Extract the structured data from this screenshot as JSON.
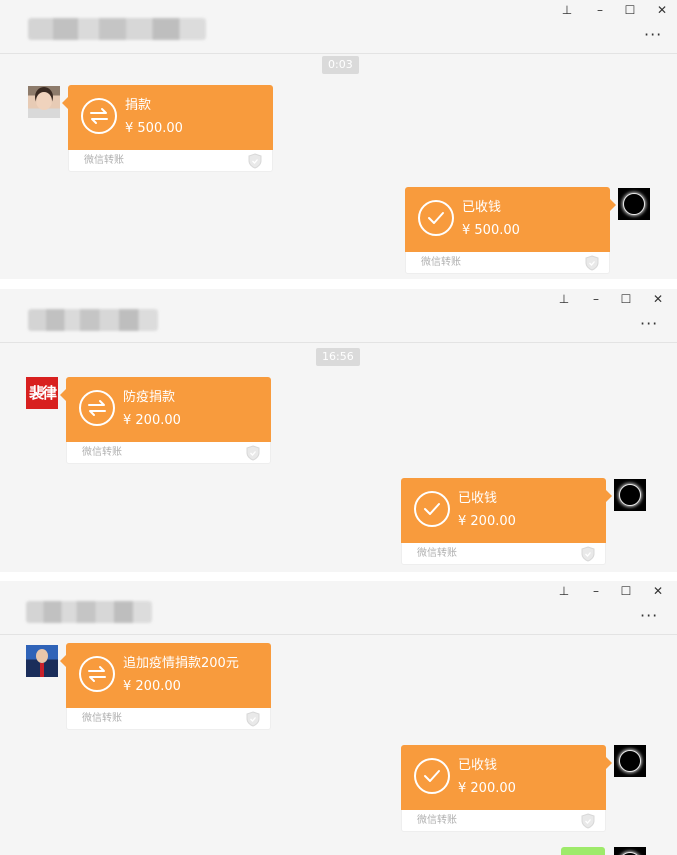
{
  "window_controls": {
    "pin": "⊥",
    "minimize": "–",
    "maximize": "☐",
    "close": "✕",
    "more": "···"
  },
  "colors": {
    "card": "#f89b3d",
    "panel": "#f5f5f5",
    "time_badge": "#dadada",
    "label_gray": "#b0b0b0"
  },
  "panels": [
    {
      "timestamp": "0:03",
      "sent": {
        "title": "捐款",
        "amount": "¥ 500.00",
        "label": "微信转账",
        "icon": "transfer-icon"
      },
      "received": {
        "title": "已收钱",
        "amount": "¥ 500.00",
        "label": "微信转账",
        "icon": "check-icon"
      }
    },
    {
      "timestamp": "16:56",
      "sent": {
        "title": "防疫捐款",
        "amount": "¥ 200.00",
        "label": "微信转账",
        "icon": "transfer-icon"
      },
      "received": {
        "title": "已收钱",
        "amount": "¥ 200.00",
        "label": "微信转账",
        "icon": "check-icon"
      }
    },
    {
      "timestamp": "",
      "sent": {
        "title": "追加疫情捐款200元",
        "amount": "¥ 200.00",
        "label": "微信转账",
        "icon": "transfer-icon"
      },
      "received": {
        "title": "已收钱",
        "amount": "¥ 200.00",
        "label": "微信转账",
        "icon": "check-icon"
      }
    }
  ],
  "avatars": {
    "panel2_left_text": "裴律"
  }
}
